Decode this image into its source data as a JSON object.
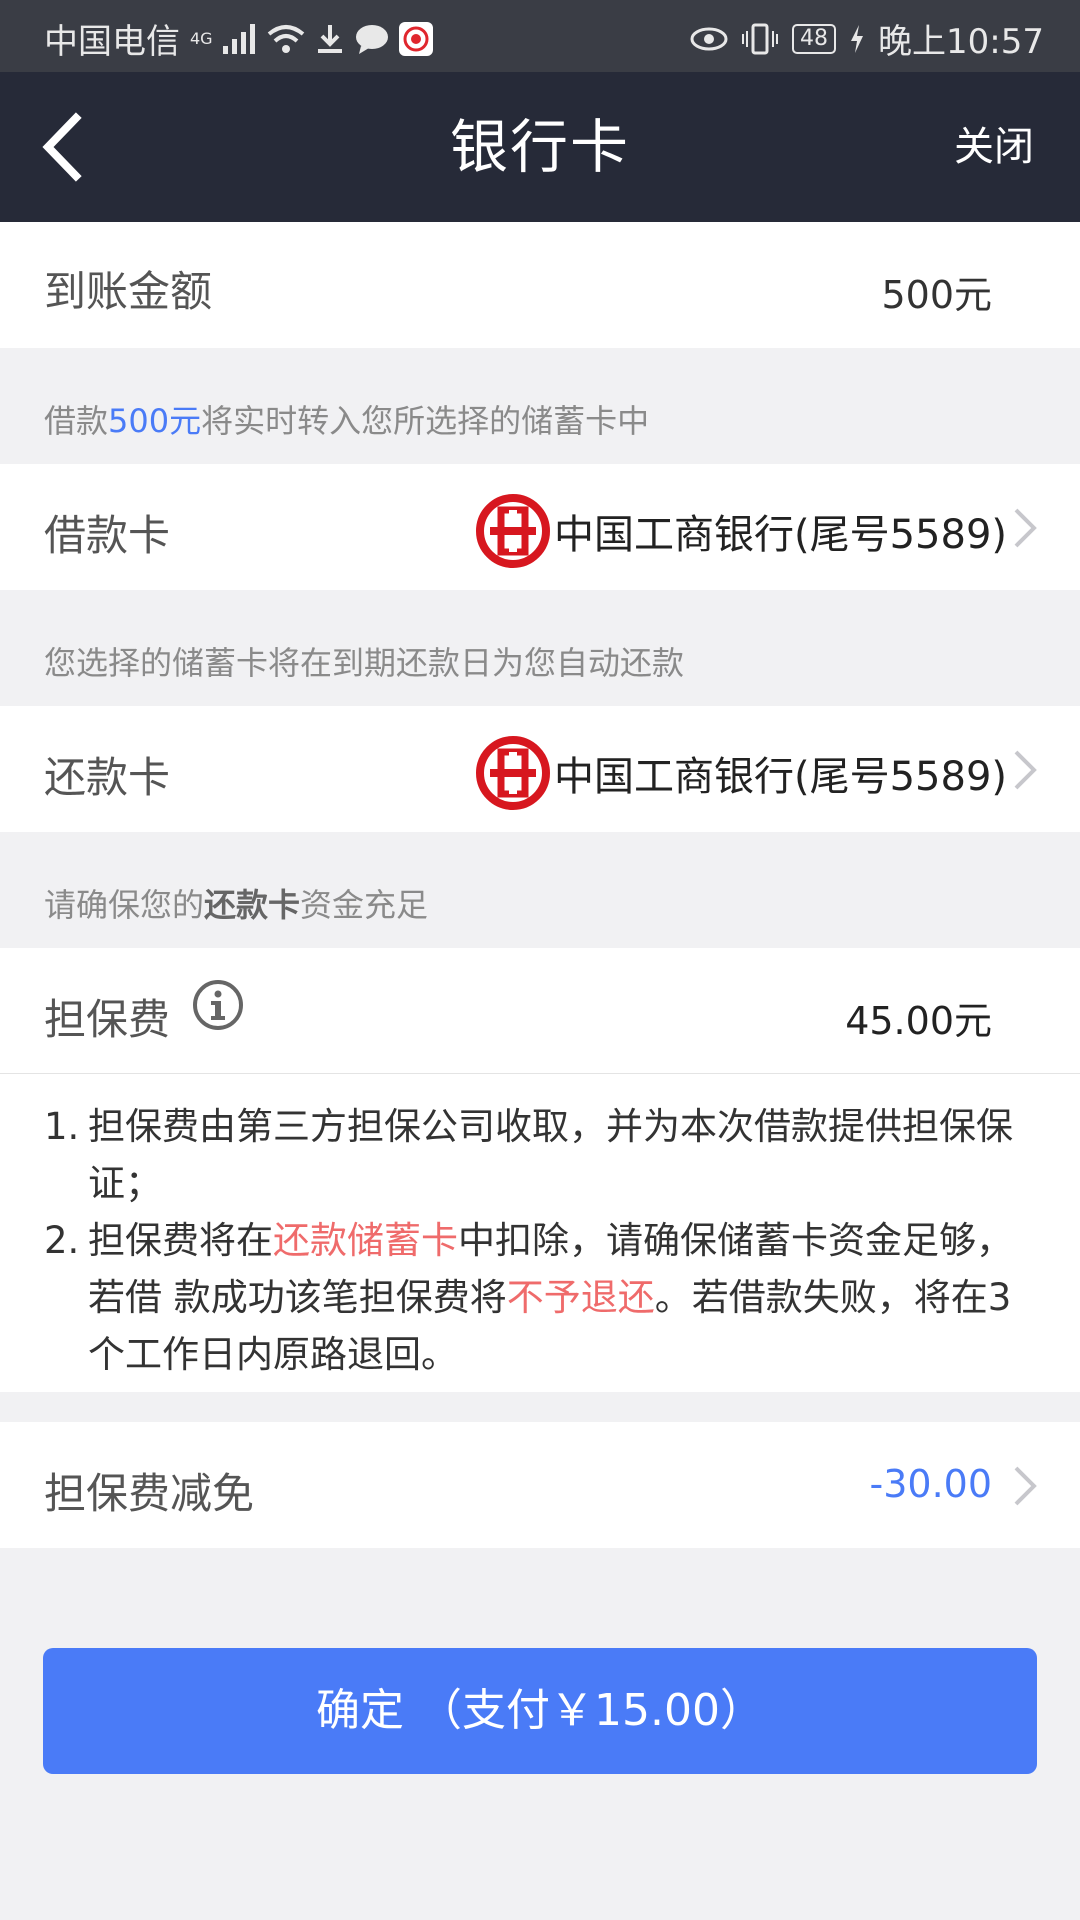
{
  "status_bar": {
    "carrier": "中国电信",
    "network": "4G",
    "battery": "48",
    "time": "晚上10:57"
  },
  "nav": {
    "title": "银行卡",
    "close_label": "关闭"
  },
  "amount_row": {
    "label": "到账金额",
    "value": "500元"
  },
  "transfer_note": {
    "prefix": "借款",
    "highlight": "500元",
    "suffix": "将实时转入您所选择的储蓄卡中"
  },
  "loan_card": {
    "label": "借款卡",
    "bank": "中国工商银行(尾号5589)",
    "icon": "icbc-logo-icon"
  },
  "repay_note": "您选择的储蓄卡将在到期还款日为您自动还款",
  "repay_card": {
    "label": "还款卡",
    "bank": "中国工商银行(尾号5589)",
    "icon": "icbc-logo-icon"
  },
  "fund_note": {
    "prefix": "请确保您的",
    "bold": "还款卡",
    "suffix": "资金充足"
  },
  "guarantee_fee": {
    "label": "担保费",
    "value": "45.00元",
    "icon": "info-icon"
  },
  "fee_terms": [
    {
      "num": "1.",
      "text": "担保费由第三方担保公司收取，并为本次借款提供担保保证；"
    },
    {
      "num": "2.",
      "t1": "担保费将在",
      "r1": "还款储蓄卡",
      "t2": "中扣除，请确保储蓄卡资金足够，若借 款成功该笔担保费将",
      "r2": "不予退还",
      "t3": "。若借款失败，将在3个工作日内原路退回。"
    }
  ],
  "fee_discount": {
    "label": "担保费减免",
    "value": "-30.00"
  },
  "confirm_button": {
    "label": "确定 （支付￥15.00）"
  },
  "colors": {
    "nav_bg": "#262a38",
    "accent_blue": "#4a7bf7",
    "warning_red": "#ef6b6b",
    "bank_red": "#d7171f"
  }
}
